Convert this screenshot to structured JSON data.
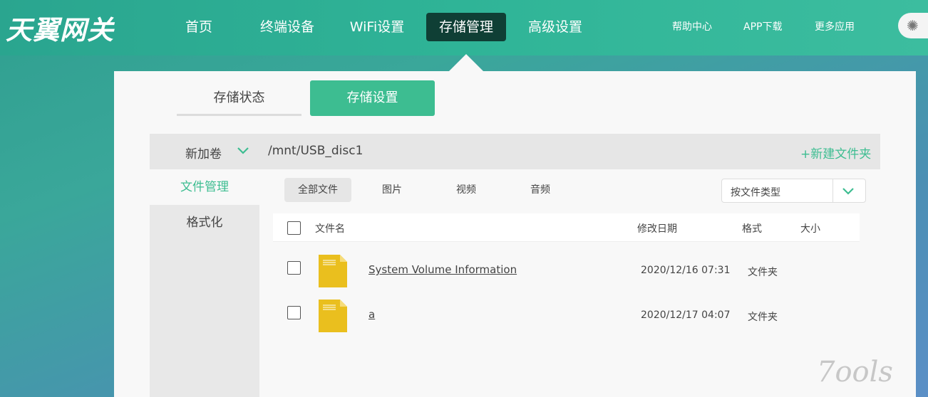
{
  "logo": "天翼网关",
  "nav": {
    "items": [
      {
        "label": "首页"
      },
      {
        "label": "终端设备"
      },
      {
        "label": "WiFi设置"
      },
      {
        "label": "存储管理"
      },
      {
        "label": "高级设置"
      }
    ],
    "right": [
      "帮助中心",
      "APP下载",
      "更多应用"
    ]
  },
  "tabs": {
    "status": "存储状态",
    "settings": "存储设置"
  },
  "volume": {
    "name": "新加卷",
    "path": "/mnt/USB_disc1",
    "new_folder": "+新建文件夹"
  },
  "sidebar": {
    "file_mgmt": "文件管理",
    "format": "格式化"
  },
  "filters": [
    "全部文件",
    "图片",
    "视频",
    "音频"
  ],
  "sort_select": {
    "label": "按文件类型"
  },
  "table": {
    "headers": {
      "name": "文件名",
      "date": "修改日期",
      "format": "格式",
      "size": "大小"
    },
    "rows": [
      {
        "name": "System Volume Information",
        "date": "2020/12/16 07:31",
        "format": "文件夹",
        "size": ""
      },
      {
        "name": "a",
        "date": "2020/12/17 04:07",
        "format": "文件夹",
        "size": ""
      }
    ]
  },
  "colors": {
    "accent": "#3dbd91",
    "nav_active": "#0f3f35",
    "folder": "#eabf1e"
  },
  "watermark": "7ools"
}
